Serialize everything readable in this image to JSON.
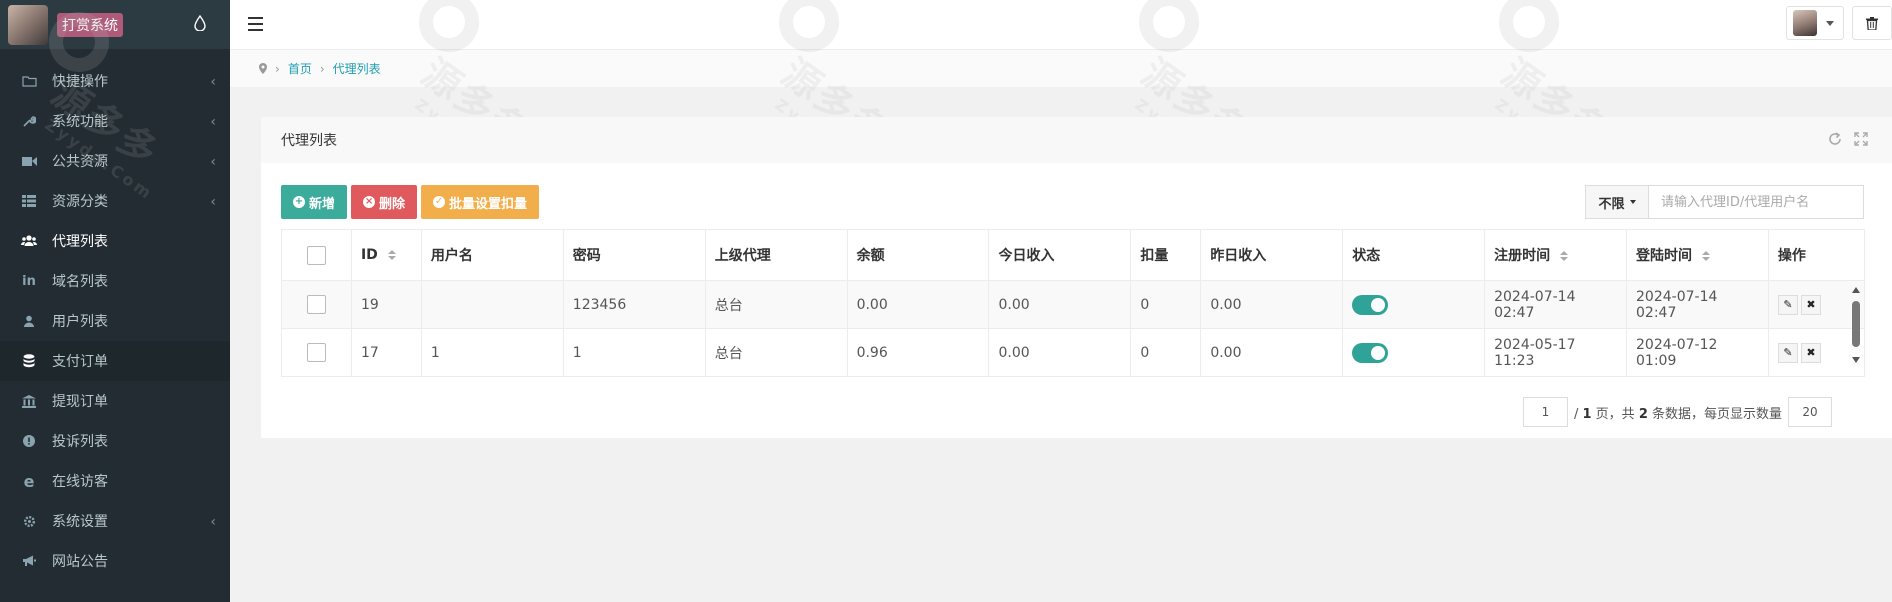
{
  "sidebar": {
    "brand_title": "打赏系统",
    "items": [
      {
        "label": "快捷操作",
        "icon": "folder-icon",
        "has_children": true
      },
      {
        "label": "系统功能",
        "icon": "wrench-icon",
        "has_children": true
      },
      {
        "label": "公共资源",
        "icon": "video-icon",
        "has_children": true
      },
      {
        "label": "资源分类",
        "icon": "grid-icon",
        "has_children": true
      },
      {
        "label": "代理列表",
        "icon": "users-icon",
        "has_children": false,
        "active": true
      },
      {
        "label": "域名列表",
        "icon": "linkedin-icon",
        "has_children": false
      },
      {
        "label": "用户列表",
        "icon": "user-icon",
        "has_children": false
      },
      {
        "label": "支付订单",
        "icon": "database-icon",
        "has_children": false
      },
      {
        "label": "提现订单",
        "icon": "bank-icon",
        "has_children": false
      },
      {
        "label": "投诉列表",
        "icon": "info-icon",
        "has_children": false
      },
      {
        "label": "在线访客",
        "icon": "edge-icon",
        "has_children": false
      },
      {
        "label": "系统设置",
        "icon": "gear-icon",
        "has_children": true
      },
      {
        "label": "网站公告",
        "icon": "bullhorn-icon",
        "has_children": false
      }
    ]
  },
  "breadcrumb": {
    "home": "首页",
    "current": "代理列表"
  },
  "panel": {
    "title": "代理列表"
  },
  "toolbar": {
    "add_label": "新增",
    "delete_label": "删除",
    "batch_label": "批量设置扣量"
  },
  "search": {
    "filter_value": "不限",
    "placeholder": "请输入代理ID/代理用户名"
  },
  "table": {
    "headers": [
      "ID",
      "用户名",
      "密码",
      "上级代理",
      "余额",
      "今日收入",
      "扣量",
      "昨日收入",
      "状态",
      "注册时间",
      "登陆时间",
      "操作"
    ],
    "rows": [
      {
        "id": "19",
        "username": "",
        "password": "123456",
        "parent": "总台",
        "balance": "0.00",
        "today": "0.00",
        "deduct": "0",
        "yesterday": "0.00",
        "status": true,
        "registered": "2024-07-14 02:47",
        "login": "2024-07-14 02:47"
      },
      {
        "id": "17",
        "username": "1",
        "password": "1",
        "parent": "总台",
        "balance": "0.96",
        "today": "0.00",
        "deduct": "0",
        "yesterday": "0.00",
        "status": true,
        "registered": "2024-05-17 11:23",
        "login": "2024-07-12 01:09"
      }
    ]
  },
  "pager": {
    "current_page": "1",
    "text_a": "/ ",
    "total_pages": "1",
    "text_b": " 页，共 ",
    "total_records": "2",
    "text_c": " 条数据，每页显示数量",
    "page_size": "20"
  },
  "colors": {
    "sidebar_bg": "#232c32",
    "accent": "#3bab9c",
    "danger": "#e0595c",
    "warning": "#f2ae4b",
    "toggle_on": "#2fa397"
  }
}
